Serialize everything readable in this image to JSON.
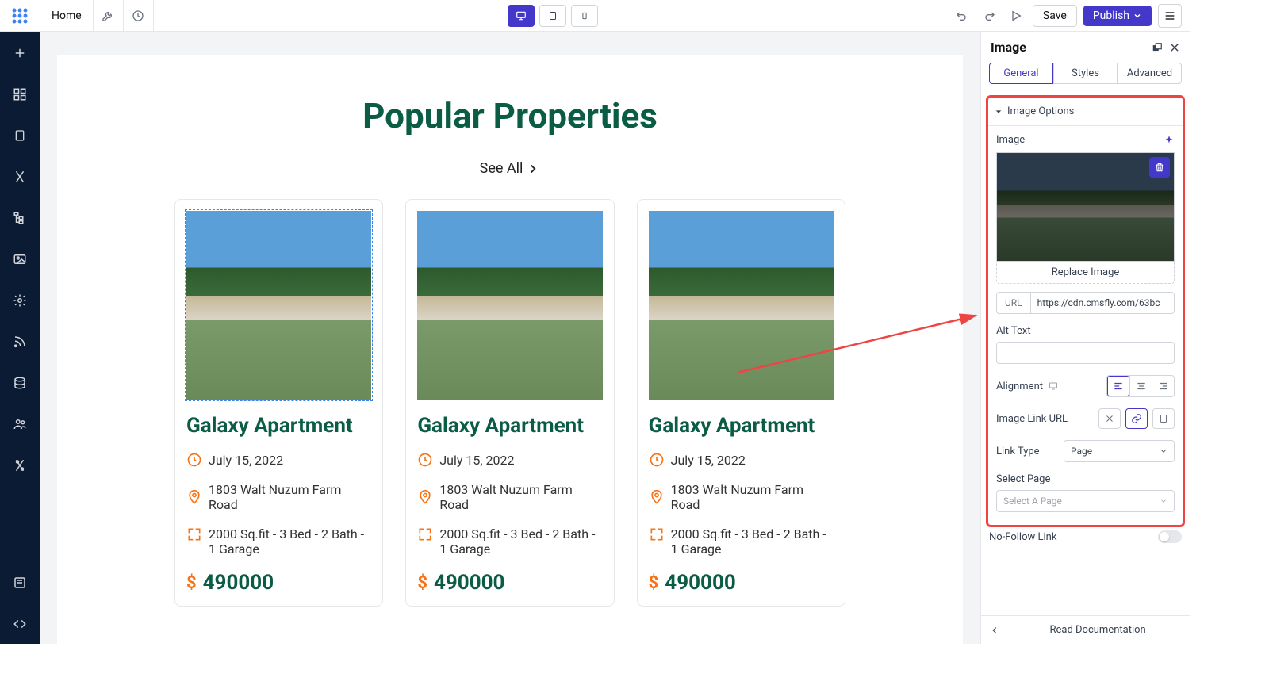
{
  "topbar": {
    "home_label": "Home",
    "save_label": "Save",
    "publish_label": "Publish"
  },
  "page": {
    "heading": "Popular Properties",
    "see_all": "See All"
  },
  "card": {
    "title": "Galaxy Apartment",
    "date": "July 15, 2022",
    "address": "1803 Walt Nuzum Farm Road",
    "details": "2000 Sq.fit - 3 Bed - 2 Bath - 1 Garage",
    "price": "490000"
  },
  "panel": {
    "title": "Image",
    "tabs": {
      "general": "General",
      "styles": "Styles",
      "advanced": "Advanced"
    },
    "image_options": "Image Options",
    "image_label": "Image",
    "replace": "Replace Image",
    "url_lbl": "URL",
    "url_value": "https://cdn.cmsfly.com/63bc",
    "alt_text": "Alt Text",
    "alignment": "Alignment",
    "image_link_url": "Image Link URL",
    "link_type": "Link Type",
    "link_type_value": "Page",
    "select_page": "Select Page",
    "select_page_placeholder": "Select A Page",
    "no_follow": "No-Follow Link",
    "read_doc": "Read Documentation"
  }
}
